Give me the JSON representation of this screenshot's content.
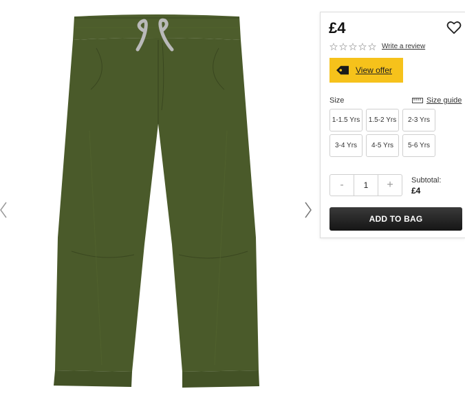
{
  "product": {
    "image_alt": "Khaki green pull-on trousers with drawstring waist",
    "color": "#4a5a2a"
  },
  "gallery": {
    "prev_icon": "chevron-left-icon",
    "next_icon": "chevron-right-icon"
  },
  "panel": {
    "price": "£4",
    "wishlist_icon": "heart-outline-icon",
    "rating": 0,
    "rating_max": 5,
    "review_link": "Write a review",
    "offer": {
      "label": "View offer",
      "icon": "tag-icon",
      "color": "#f6c21b"
    },
    "size": {
      "label": "Size",
      "guide_label": "Size guide",
      "guide_icon": "ruler-icon",
      "options": [
        "1-1.5 Yrs",
        "1.5-2 Yrs",
        "2-3 Yrs",
        "3-4 Yrs",
        "4-5 Yrs",
        "5-6 Yrs"
      ]
    },
    "quantity": {
      "minus": "-",
      "value": "1",
      "plus": "+"
    },
    "subtotal": {
      "label": "Subtotal:",
      "value": "£4"
    },
    "add_to_bag": "ADD TO BAG"
  }
}
